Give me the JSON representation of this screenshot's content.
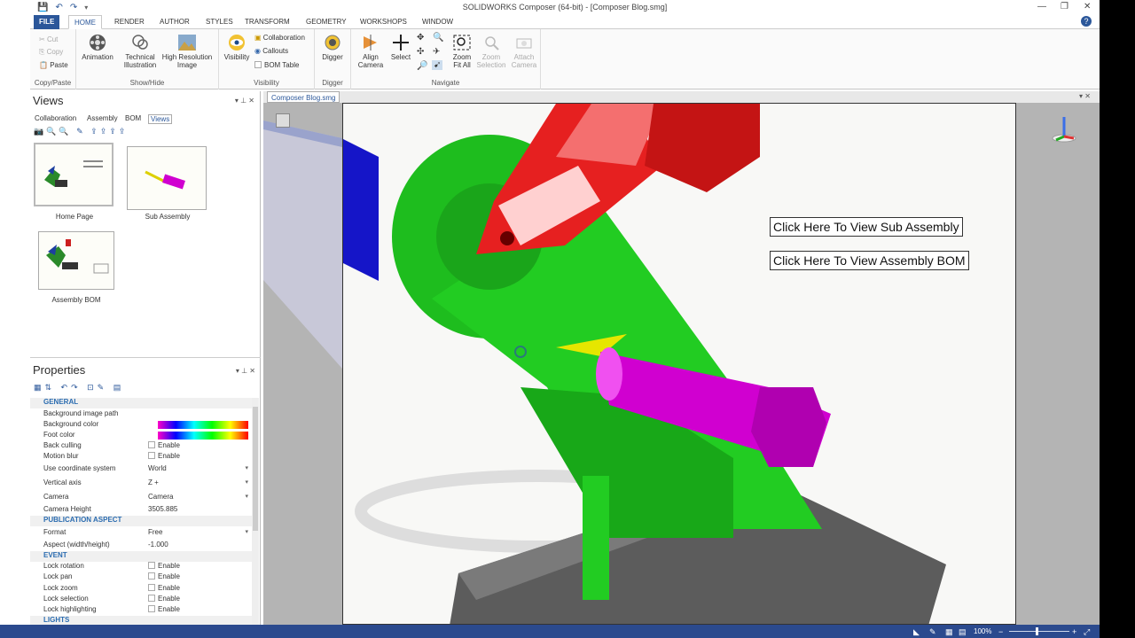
{
  "app": {
    "title": "SOLIDWORKS Composer (64-bit) - [Composer Blog.smg]"
  },
  "tabs": [
    "FILE",
    "HOME",
    "RENDER",
    "AUTHOR",
    "STYLES",
    "TRANSFORM",
    "GEOMETRY",
    "WORKSHOPS",
    "WINDOW"
  ],
  "ribbon": {
    "copy_paste": {
      "cut": "Cut",
      "copy": "Copy",
      "paste": "Paste",
      "group": "Copy/Paste"
    },
    "show_hide": {
      "animation": "Animation",
      "technical": "Technical Illustration",
      "hires": "High Resolution Image",
      "group": "Show/Hide"
    },
    "visibility": {
      "visibility": "Visibility",
      "collaboration": "Collaboration",
      "callouts": "Callouts",
      "bom_table": "BOM Table",
      "group": "Visibility"
    },
    "digger": {
      "digger": "Digger",
      "group": "Digger"
    },
    "navigate": {
      "align": "Align Camera",
      "select": "Select",
      "zoom_fit": "Zoom Fit All",
      "zoom_sel": "Zoom Selection",
      "attach": "Attach Camera",
      "group": "Navigate"
    }
  },
  "views_panel": {
    "title": "Views",
    "subtabs": [
      "Collaboration",
      "Assembly",
      "BOM",
      "Views"
    ],
    "thumbs": [
      {
        "label": "Home Page"
      },
      {
        "label": "Sub Assembly"
      },
      {
        "label": "Assembly BOM"
      }
    ]
  },
  "properties": {
    "title": "Properties",
    "sections": {
      "general": "GENERAL",
      "publication": "PUBLICATION ASPECT",
      "event": "EVENT",
      "lights": "LIGHTS"
    },
    "rows": {
      "bg_image": "Background image path",
      "bg_color": "Background color",
      "foot_color": "Foot color",
      "back_culling": "Back culling",
      "back_culling_v": "Enable",
      "motion_blur": "Motion blur",
      "motion_blur_v": "Enable",
      "coord": "Use coordinate system",
      "coord_v": "World",
      "vaxis": "Vertical axis",
      "vaxis_v": "Z +",
      "camera": "Camera",
      "camera_v": "Camera",
      "cam_height": "Camera Height",
      "cam_height_v": "3505.885",
      "format": "Format",
      "format_v": "Free",
      "aspect": "Aspect (width/height)",
      "aspect_v": "-1.000",
      "lock_rot": "Lock rotation",
      "lock_pan": "Lock pan",
      "lock_zoom": "Lock zoom",
      "lock_sel": "Lock selection",
      "lock_hl": "Lock highlighting",
      "enable": "Enable"
    }
  },
  "document": {
    "tab": "Composer Blog.smg"
  },
  "viewport": {
    "btn_sub": "Click Here To View Sub Assembly",
    "btn_bom": "Click Here To View Assembly BOM"
  },
  "status": {
    "zoom": "100%"
  }
}
